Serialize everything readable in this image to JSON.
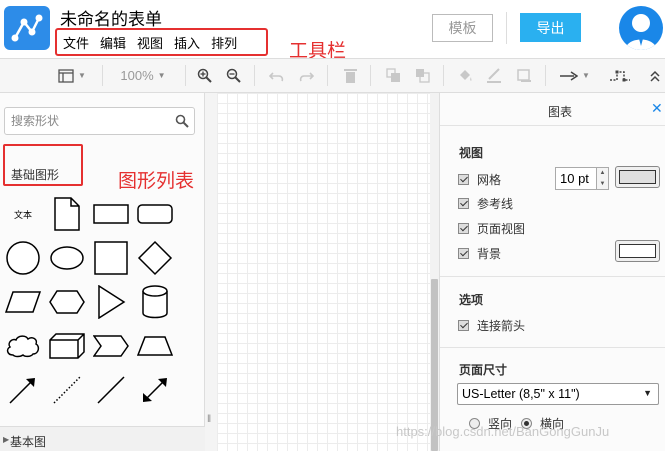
{
  "header": {
    "title": "未命名的表单",
    "menu": [
      "文件",
      "编辑",
      "视图",
      "插入",
      "排列"
    ],
    "annotation_toolbar": "工具栏",
    "template_button": "模板",
    "export_button": "导出",
    "accent": "#2ab0f0"
  },
  "toolbar": {
    "zoom": "100%",
    "icons": [
      "page-view-icon",
      "zoom-in-icon",
      "zoom-out-icon",
      "undo-icon",
      "redo-icon",
      "delete-icon",
      "to-front-icon",
      "to-back-icon",
      "fill-color-icon",
      "line-color-icon",
      "shadow-icon",
      "connection-icon",
      "waypoints-icon",
      "collapse-icon"
    ]
  },
  "left_panel": {
    "search_placeholder": "搜索形状",
    "section_title": "基础图形",
    "annotation_shapes": "图形列表",
    "text_shape_label": "文本",
    "bottom_section": "基本图"
  },
  "right_panel": {
    "tab_title": "图表",
    "view_section": "视图",
    "grid_label": "网格",
    "grid_size": "10 pt",
    "guides_label": "参考线",
    "page_view_label": "页面视图",
    "background_label": "背景",
    "options_section": "选项",
    "connection_arrows_label": "连接箭头",
    "page_size_section": "页面尺寸",
    "page_size_value": "US-Letter (8,5\" x 11\")",
    "portrait_label": "竖向",
    "landscape_label": "横向"
  },
  "watermark": "https://blog.csdn.net/BanGongGunJu"
}
